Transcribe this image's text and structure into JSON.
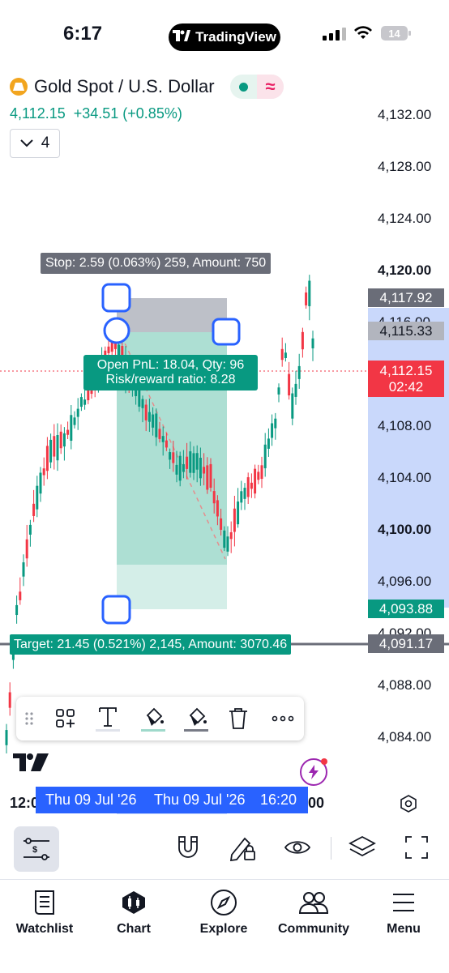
{
  "status_bar": {
    "time": "6:17",
    "app_pill": "TradingView",
    "battery": "14"
  },
  "symbol": {
    "title": "Gold Spot / U.S. Dollar",
    "price_line": "4,112.15  +34.51 (+0.85%)",
    "interval": "4"
  },
  "y_axis": [
    "4,132.00",
    "4,128.00",
    "4,124.00",
    "4,120.00",
    "4,116.00",
    "4,108.00",
    "4,104.00",
    "4,100.00",
    "4,096.00",
    "4,092.00",
    "4,088.00",
    "4,084.00"
  ],
  "y_axis_bold": [
    "4,120.00",
    "4,100.00"
  ],
  "price_tags": {
    "stop_level": "4,117.92",
    "entry_level": "4,115.33",
    "current": "4,112.15",
    "countdown": "02:42",
    "low_tag": "4,093.88",
    "target_level": "4,091.17"
  },
  "position": {
    "stop_label": "Stop: 2.59 (0.063%) 259, Amount: 750",
    "pnl_line1": "Open PnL: 18.04, Qty: 96",
    "pnl_line2": "Risk/reward ratio: 8.28",
    "target_label": "Target: 21.45 (0.521%) 2,145, Amount: 3070.46"
  },
  "x_axis": {
    "left": "12:0",
    "date1": "Thu 09 Jul '26",
    "date2": "Thu 09 Jul '26",
    "time": "16:20",
    "right": "00"
  },
  "tabs": [
    {
      "label": "Watchlist",
      "icon": "book-icon"
    },
    {
      "label": "Chart",
      "icon": "candles-icon"
    },
    {
      "label": "Explore",
      "icon": "compass-icon"
    },
    {
      "label": "Community",
      "icon": "people-icon"
    },
    {
      "label": "Menu",
      "icon": "menu-icon"
    }
  ],
  "colors": {
    "up": "#089981",
    "down": "#f23645",
    "accent": "#2962ff",
    "profit_zone": "#9fd9cb",
    "loss_zone": "#b2b5be"
  }
}
